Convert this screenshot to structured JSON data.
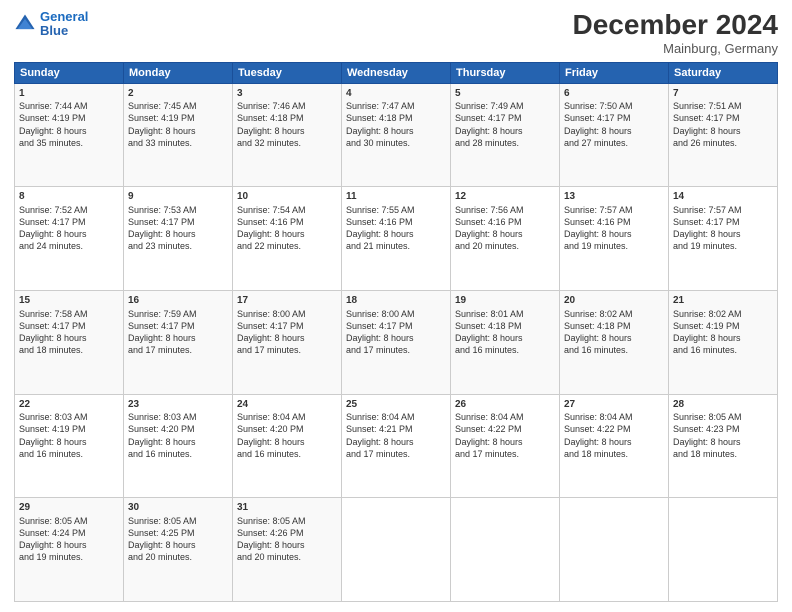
{
  "header": {
    "logo_line1": "General",
    "logo_line2": "Blue",
    "month": "December 2024",
    "location": "Mainburg, Germany"
  },
  "days_of_week": [
    "Sunday",
    "Monday",
    "Tuesday",
    "Wednesday",
    "Thursday",
    "Friday",
    "Saturday"
  ],
  "weeks": [
    [
      {
        "day": "1",
        "lines": [
          "Sunrise: 7:44 AM",
          "Sunset: 4:19 PM",
          "Daylight: 8 hours",
          "and 35 minutes."
        ]
      },
      {
        "day": "2",
        "lines": [
          "Sunrise: 7:45 AM",
          "Sunset: 4:19 PM",
          "Daylight: 8 hours",
          "and 33 minutes."
        ]
      },
      {
        "day": "3",
        "lines": [
          "Sunrise: 7:46 AM",
          "Sunset: 4:18 PM",
          "Daylight: 8 hours",
          "and 32 minutes."
        ]
      },
      {
        "day": "4",
        "lines": [
          "Sunrise: 7:47 AM",
          "Sunset: 4:18 PM",
          "Daylight: 8 hours",
          "and 30 minutes."
        ]
      },
      {
        "day": "5",
        "lines": [
          "Sunrise: 7:49 AM",
          "Sunset: 4:17 PM",
          "Daylight: 8 hours",
          "and 28 minutes."
        ]
      },
      {
        "day": "6",
        "lines": [
          "Sunrise: 7:50 AM",
          "Sunset: 4:17 PM",
          "Daylight: 8 hours",
          "and 27 minutes."
        ]
      },
      {
        "day": "7",
        "lines": [
          "Sunrise: 7:51 AM",
          "Sunset: 4:17 PM",
          "Daylight: 8 hours",
          "and 26 minutes."
        ]
      }
    ],
    [
      {
        "day": "8",
        "lines": [
          "Sunrise: 7:52 AM",
          "Sunset: 4:17 PM",
          "Daylight: 8 hours",
          "and 24 minutes."
        ]
      },
      {
        "day": "9",
        "lines": [
          "Sunrise: 7:53 AM",
          "Sunset: 4:17 PM",
          "Daylight: 8 hours",
          "and 23 minutes."
        ]
      },
      {
        "day": "10",
        "lines": [
          "Sunrise: 7:54 AM",
          "Sunset: 4:16 PM",
          "Daylight: 8 hours",
          "and 22 minutes."
        ]
      },
      {
        "day": "11",
        "lines": [
          "Sunrise: 7:55 AM",
          "Sunset: 4:16 PM",
          "Daylight: 8 hours",
          "and 21 minutes."
        ]
      },
      {
        "day": "12",
        "lines": [
          "Sunrise: 7:56 AM",
          "Sunset: 4:16 PM",
          "Daylight: 8 hours",
          "and 20 minutes."
        ]
      },
      {
        "day": "13",
        "lines": [
          "Sunrise: 7:57 AM",
          "Sunset: 4:16 PM",
          "Daylight: 8 hours",
          "and 19 minutes."
        ]
      },
      {
        "day": "14",
        "lines": [
          "Sunrise: 7:57 AM",
          "Sunset: 4:17 PM",
          "Daylight: 8 hours",
          "and 19 minutes."
        ]
      }
    ],
    [
      {
        "day": "15",
        "lines": [
          "Sunrise: 7:58 AM",
          "Sunset: 4:17 PM",
          "Daylight: 8 hours",
          "and 18 minutes."
        ]
      },
      {
        "day": "16",
        "lines": [
          "Sunrise: 7:59 AM",
          "Sunset: 4:17 PM",
          "Daylight: 8 hours",
          "and 17 minutes."
        ]
      },
      {
        "day": "17",
        "lines": [
          "Sunrise: 8:00 AM",
          "Sunset: 4:17 PM",
          "Daylight: 8 hours",
          "and 17 minutes."
        ]
      },
      {
        "day": "18",
        "lines": [
          "Sunrise: 8:00 AM",
          "Sunset: 4:17 PM",
          "Daylight: 8 hours",
          "and 17 minutes."
        ]
      },
      {
        "day": "19",
        "lines": [
          "Sunrise: 8:01 AM",
          "Sunset: 4:18 PM",
          "Daylight: 8 hours",
          "and 16 minutes."
        ]
      },
      {
        "day": "20",
        "lines": [
          "Sunrise: 8:02 AM",
          "Sunset: 4:18 PM",
          "Daylight: 8 hours",
          "and 16 minutes."
        ]
      },
      {
        "day": "21",
        "lines": [
          "Sunrise: 8:02 AM",
          "Sunset: 4:19 PM",
          "Daylight: 8 hours",
          "and 16 minutes."
        ]
      }
    ],
    [
      {
        "day": "22",
        "lines": [
          "Sunrise: 8:03 AM",
          "Sunset: 4:19 PM",
          "Daylight: 8 hours",
          "and 16 minutes."
        ]
      },
      {
        "day": "23",
        "lines": [
          "Sunrise: 8:03 AM",
          "Sunset: 4:20 PM",
          "Daylight: 8 hours",
          "and 16 minutes."
        ]
      },
      {
        "day": "24",
        "lines": [
          "Sunrise: 8:04 AM",
          "Sunset: 4:20 PM",
          "Daylight: 8 hours",
          "and 16 minutes."
        ]
      },
      {
        "day": "25",
        "lines": [
          "Sunrise: 8:04 AM",
          "Sunset: 4:21 PM",
          "Daylight: 8 hours",
          "and 17 minutes."
        ]
      },
      {
        "day": "26",
        "lines": [
          "Sunrise: 8:04 AM",
          "Sunset: 4:22 PM",
          "Daylight: 8 hours",
          "and 17 minutes."
        ]
      },
      {
        "day": "27",
        "lines": [
          "Sunrise: 8:04 AM",
          "Sunset: 4:22 PM",
          "Daylight: 8 hours",
          "and 18 minutes."
        ]
      },
      {
        "day": "28",
        "lines": [
          "Sunrise: 8:05 AM",
          "Sunset: 4:23 PM",
          "Daylight: 8 hours",
          "and 18 minutes."
        ]
      }
    ],
    [
      {
        "day": "29",
        "lines": [
          "Sunrise: 8:05 AM",
          "Sunset: 4:24 PM",
          "Daylight: 8 hours",
          "and 19 minutes."
        ]
      },
      {
        "day": "30",
        "lines": [
          "Sunrise: 8:05 AM",
          "Sunset: 4:25 PM",
          "Daylight: 8 hours",
          "and 20 minutes."
        ]
      },
      {
        "day": "31",
        "lines": [
          "Sunrise: 8:05 AM",
          "Sunset: 4:26 PM",
          "Daylight: 8 hours",
          "and 20 minutes."
        ]
      },
      null,
      null,
      null,
      null
    ]
  ]
}
